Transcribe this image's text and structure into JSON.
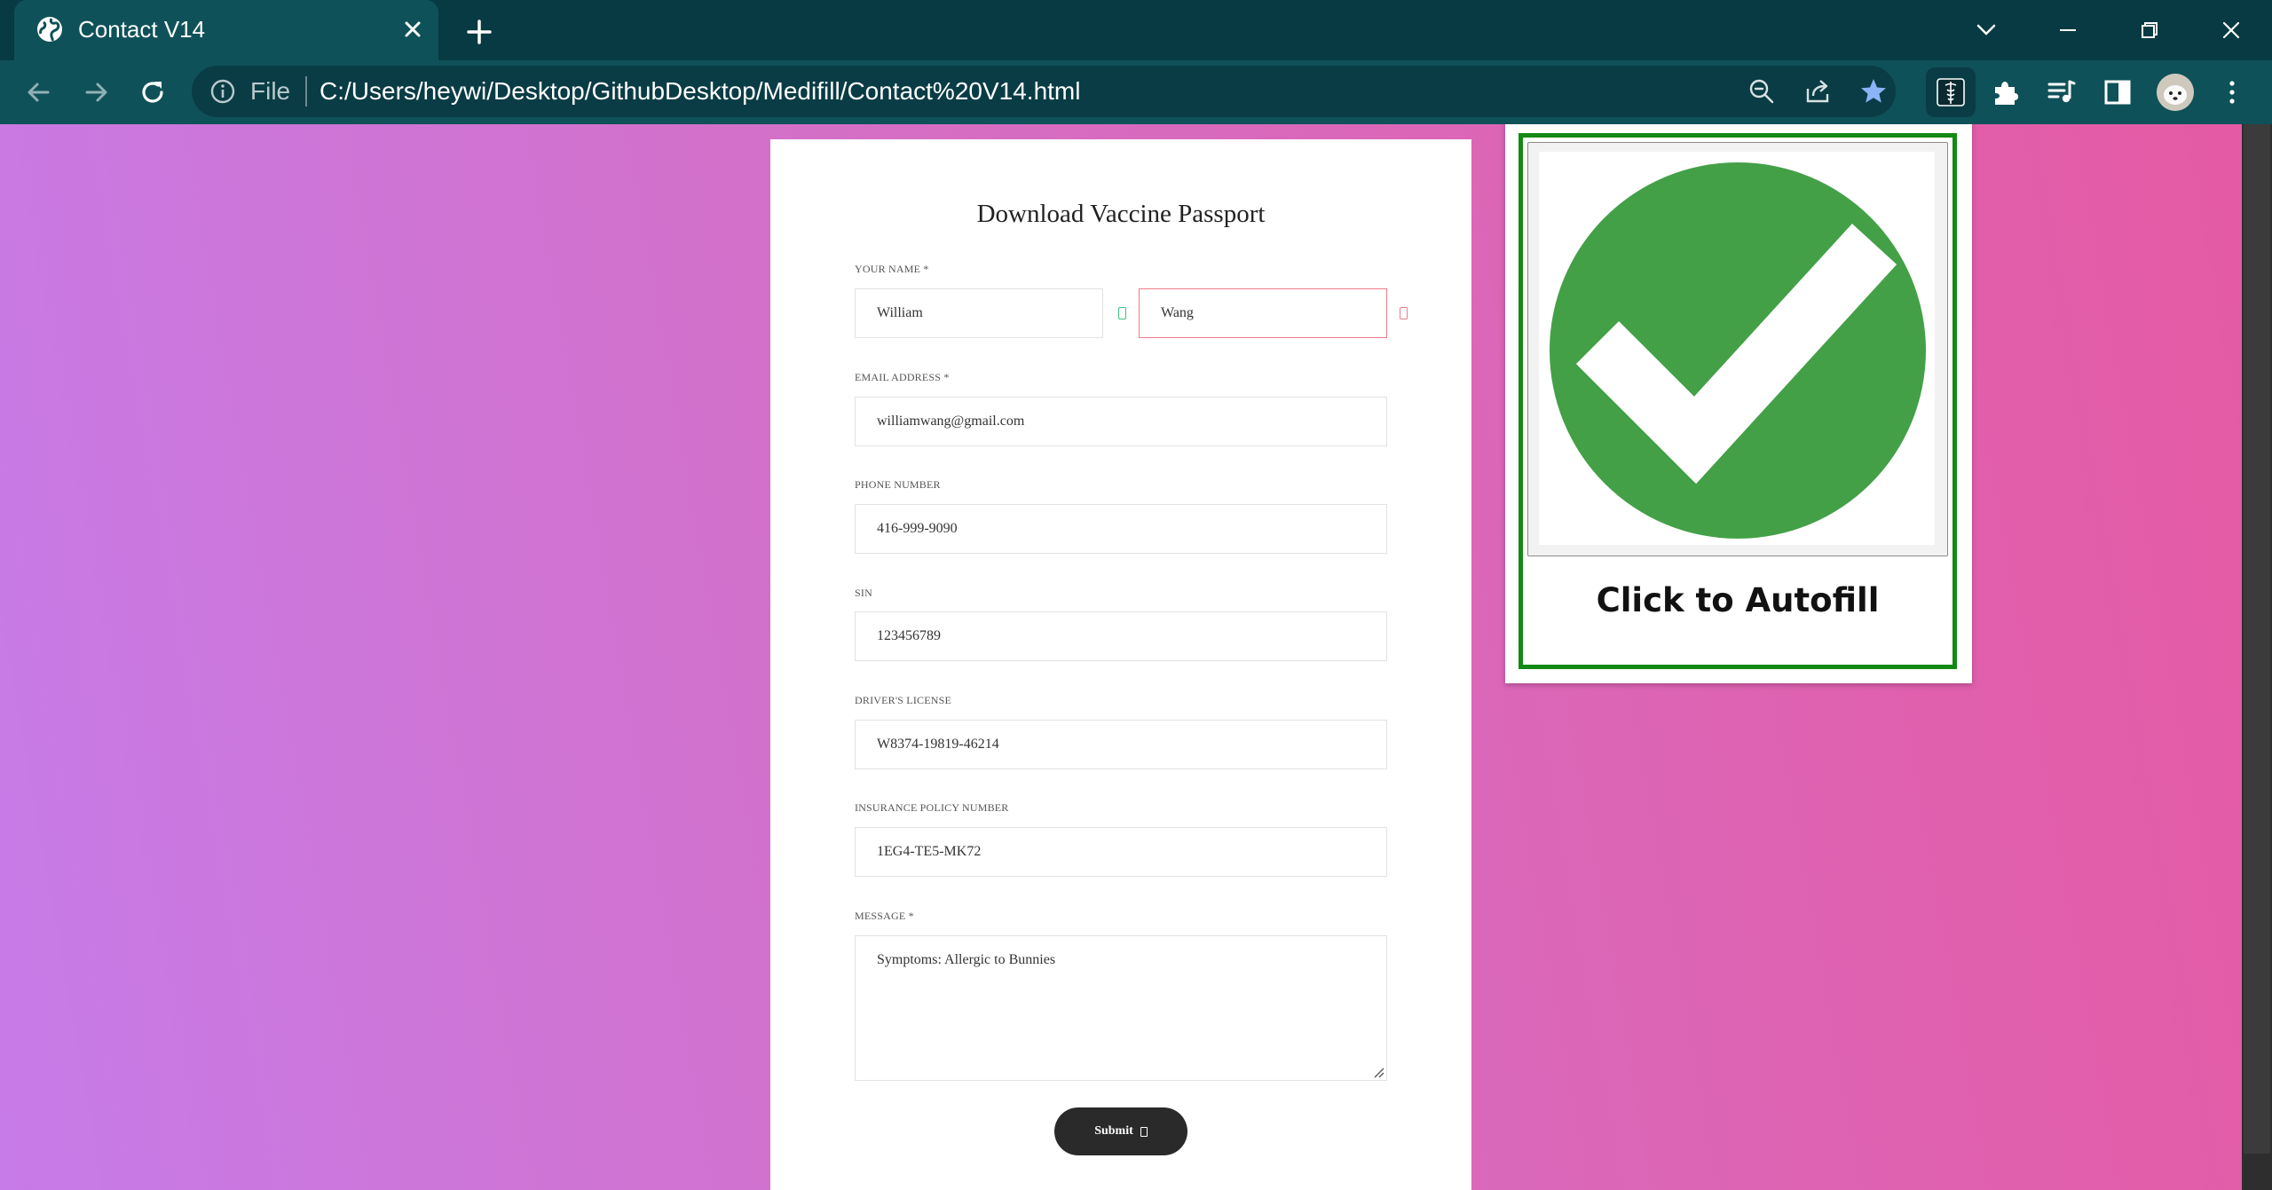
{
  "browser": {
    "tab_title": "Contact V14",
    "address_scheme": "File",
    "url": "C:/Users/heywi/Desktop/GithubDesktop/Medifill/Contact%20V14.html"
  },
  "form": {
    "title": "Download Vaccine Passport",
    "name": {
      "label": "YOUR NAME *",
      "first": "William",
      "last": "Wang"
    },
    "email": {
      "label": "EMAIL ADDRESS *",
      "value": "williamwang@gmail.com"
    },
    "phone": {
      "label": "PHONE NUMBER",
      "value": "416-999-9090"
    },
    "sin": {
      "label": "SIN",
      "value": "123456789"
    },
    "license": {
      "label": "DRIVER'S LICENSE",
      "value": "W8374-19819-46214"
    },
    "insurance": {
      "label": "INSURANCE POLICY NUMBER",
      "value": "1EG4-TE5-MK72"
    },
    "message": {
      "label": "MESSAGE *",
      "value": "Symptoms: Allergic to Bunnies"
    },
    "submit_label": "Submit"
  },
  "popup": {
    "label": "Click to Autofill",
    "image_icon": "green-checkmark-circle"
  },
  "colors": {
    "chrome_dark": "#073a42",
    "chrome_toolbar": "#0f5159",
    "popup_border": "#138a13",
    "check_green": "#43a047",
    "error_border": "#ef7b87"
  }
}
